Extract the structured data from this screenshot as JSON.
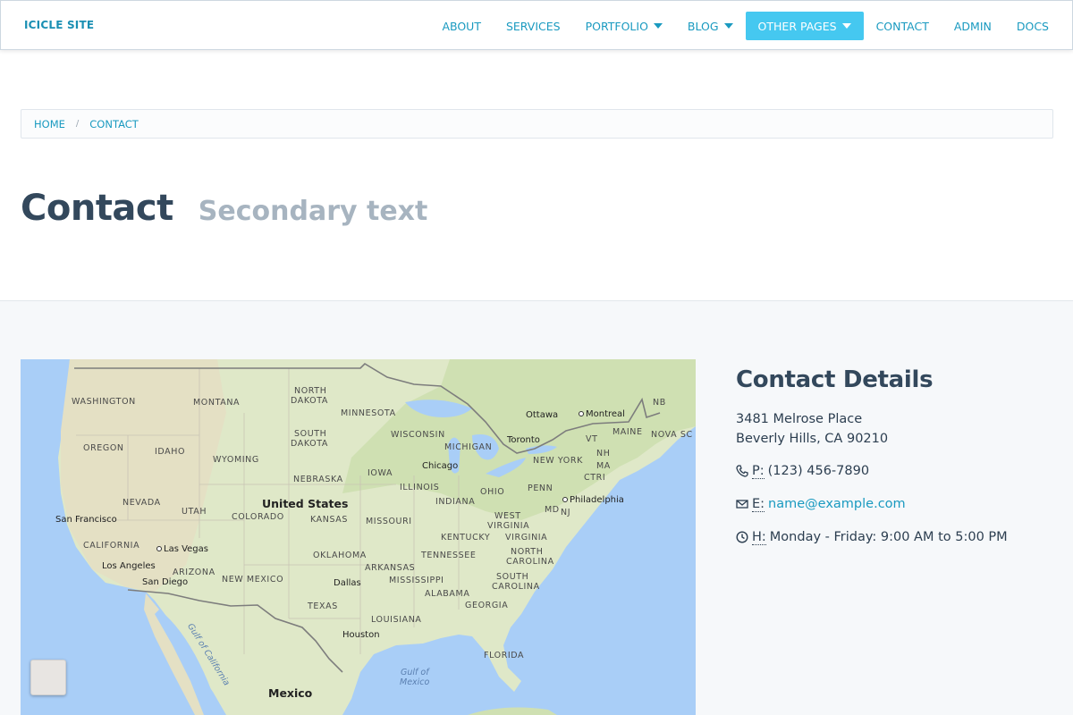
{
  "brand": "ICICLE SITE",
  "nav": {
    "about": "ABOUT",
    "services": "SERVICES",
    "portfolio": "PORTFOLIO",
    "blog": "BLOG",
    "other_pages": "OTHER PAGES",
    "contact": "CONTACT",
    "admin": "ADMIN",
    "docs": "DOCS"
  },
  "breadcrumb": {
    "home": "HOME",
    "separator": "/",
    "current": "CONTACT"
  },
  "page": {
    "title": "Contact",
    "subtitle": "Secondary text"
  },
  "map": {
    "country_main": "United States",
    "country_south": "Mexico",
    "gulf_california": "Gulf of California",
    "gulf_mexico_1": "Gulf of",
    "gulf_mexico_2": "Mexico",
    "states": {
      "washington": "WASHINGTON",
      "montana": "MONTANA",
      "north_dakota_1": "NORTH",
      "north_dakota_2": "DAKOTA",
      "minnesota": "MINNESOTA",
      "oregon": "OREGON",
      "idaho": "IDAHO",
      "south_dakota_1": "SOUTH",
      "south_dakota_2": "DAKOTA",
      "wisconsin": "WISCONSIN",
      "michigan": "MICHIGAN",
      "wyoming": "WYOMING",
      "nebraska": "NEBRASKA",
      "iowa": "IOWA",
      "illinois": "ILLINOIS",
      "ohio": "OHIO",
      "penn": "PENN",
      "nevada": "NEVADA",
      "utah": "UTAH",
      "colorado": "COLORADO",
      "kansas": "KANSAS",
      "missouri": "MISSOURI",
      "indiana": "INDIANA",
      "west_virginia_1": "WEST",
      "west_virginia_2": "VIRGINIA",
      "california": "CALIFORNIA",
      "kentucky": "KENTUCKY",
      "virginia": "VIRGINIA",
      "arizona": "ARIZONA",
      "new_mexico": "NEW MEXICO",
      "oklahoma": "OKLAHOMA",
      "tennessee": "TENNESSEE",
      "north_carolina_1": "NORTH",
      "north_carolina_2": "CAROLINA",
      "arkansas": "ARKANSAS",
      "mississippi": "MISSISSIPPI",
      "south_carolina_1": "SOUTH",
      "south_carolina_2": "CAROLINA",
      "alabama": "ALABAMA",
      "georgia": "GEORGIA",
      "texas": "TEXAS",
      "louisiana": "LOUISIANA",
      "florida": "FLORIDA",
      "maine": "MAINE",
      "vt": "VT",
      "nh": "NH",
      "new_york": "NEW YORK",
      "ma": "MA",
      "ct": "CTRI",
      "md": "MD",
      "nj": "NJ",
      "nb": "NB",
      "ns": "NOVA SC"
    },
    "cities": {
      "ottawa": "Ottawa",
      "montreal": "Montreal",
      "toronto": "Toronto",
      "chicago": "Chicago",
      "philadelphia": "Philadelphia",
      "san_francisco": "San Francisco",
      "las_vegas": "Las Vegas",
      "los_angeles": "Los Angeles",
      "san_diego": "San Diego",
      "dallas": "Dallas",
      "houston": "Houston"
    }
  },
  "contact": {
    "heading": "Contact Details",
    "address_line1": "3481 Melrose Place",
    "address_line2": "Beverly Hills, CA 90210",
    "phone_abbr": "P:",
    "phone": "(123) 456-7890",
    "email_abbr": "E:",
    "email": "name@example.com",
    "hours_abbr": "H:",
    "hours": "Monday - Friday: 9:00 AM to 5:00 PM"
  },
  "colors": {
    "accent": "#1a9ac0",
    "active_nav": "#45c8f0",
    "title": "#33485c",
    "subtitle": "#a7b4c0"
  }
}
